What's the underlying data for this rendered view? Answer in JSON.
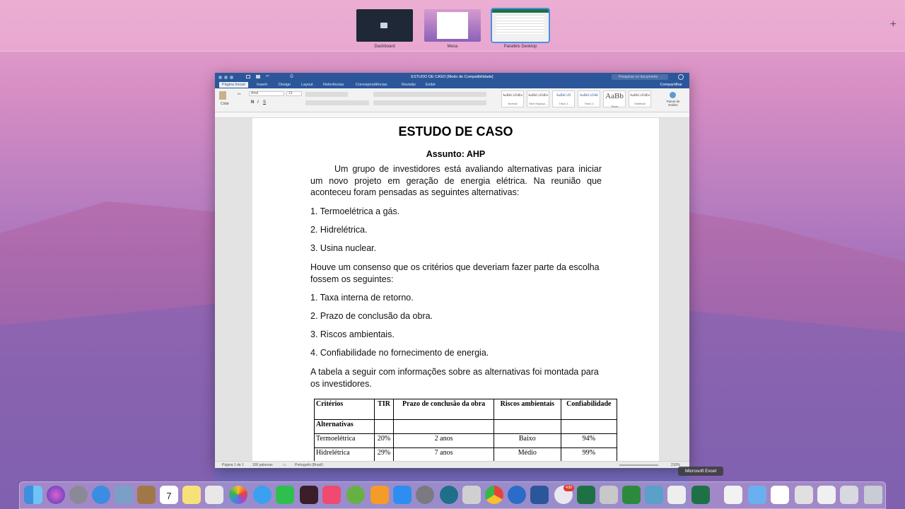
{
  "spaces": [
    {
      "label": "Dashboard"
    },
    {
      "label": "Mesa"
    },
    {
      "label": "Parallels Desktop"
    }
  ],
  "word": {
    "title": "ESTUDO DE CASO [Modo de Compatibilidade]",
    "search_placeholder": "Pesquisar no documento",
    "tabs": [
      "Página Inicial",
      "Inserir",
      "Design",
      "Layout",
      "Referências",
      "Correspondências",
      "Revisão",
      "Exibir"
    ],
    "share": "Compartilhar",
    "ribbon": {
      "paste": "Colar",
      "font": "Arial",
      "size": "13",
      "styles": [
        {
          "sample": "AaBbCcDdEe",
          "name": "Normal"
        },
        {
          "sample": "AaBbCcDdEe",
          "name": "Sem Espaça..."
        },
        {
          "sample": "AaBbCcD",
          "name": "Título 1"
        },
        {
          "sample": "AaBbCcDdE",
          "name": "Título 2"
        },
        {
          "sample": "AaBb",
          "name": "Título"
        },
        {
          "sample": "AaBbCcDdEe",
          "name": "Subtítulo"
        }
      ],
      "styles_pane": "Painel de Estilos"
    },
    "status": {
      "page": "Página 1 de 1",
      "words": "100 palavras",
      "language": "Português (Brasil)",
      "zoom": "210%"
    }
  },
  "document": {
    "title": "ESTUDO DE CASO",
    "subject": "Assunto: AHP",
    "intro": "Um grupo de investidores está avaliando alternativas para iniciar um novo projeto em geração de energia elétrica. Na reunião que aconteceu foram pensadas as seguintes alternativas:",
    "alternatives": [
      "1. Termoelétrica a gás.",
      "2. Hidrelétrica.",
      "3. Usina nuclear."
    ],
    "consensus": "Houve um consenso que os critérios que deveriam fazer parte da escolha fossem os seguintes:",
    "criteria": [
      "1. Taxa interna de retorno.",
      "2. Prazo de conclusão da obra.",
      "3. Riscos ambientais.",
      "4. Confiabilidade no fornecimento de energia."
    ],
    "table_intro": "A tabela a seguir com informações sobre as alternativas foi montada para os investidores.",
    "table": {
      "headers": [
        "Critérios",
        "TIR",
        "Prazo de conclusão da obra",
        "Riscos ambientais",
        "Confiabilidade"
      ],
      "subheader": "Alternativas",
      "rows": [
        [
          "Termoelétrica",
          "20%",
          "2 anos",
          "Baixo",
          "94%"
        ],
        [
          "Hidrelétrica",
          "29%",
          "7 anos",
          "Médio",
          "99%"
        ]
      ]
    }
  },
  "dock": {
    "tooltip": "Microsoft Excel",
    "mail_badge": "430",
    "calendar_day": "7"
  }
}
